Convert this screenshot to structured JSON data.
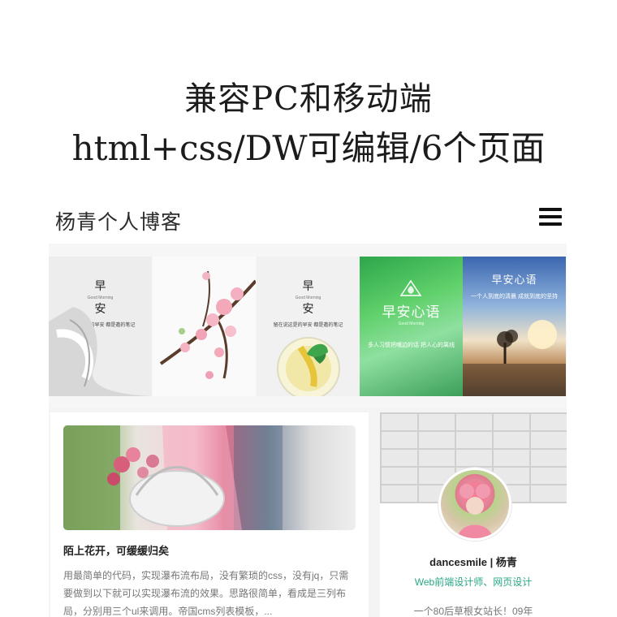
{
  "promo": {
    "line1": "兼容PC和移动端",
    "line2": "html+css/DW可编辑/6个页面"
  },
  "header": {
    "logo": "杨青个人博客",
    "menu_icon": "hamburger-menu-icon"
  },
  "banner": {
    "tiles": [
      {
        "kind": "card",
        "char1": "早",
        "char2": "安",
        "tiny": "Good Morning",
        "text": "留在说这是的早安 都是邀的笔记"
      },
      {
        "kind": "blossom"
      },
      {
        "kind": "card",
        "char1": "早",
        "char2": "安",
        "tiny": "Good Morning",
        "text": "留在说这是的早安 都是邀的笔记"
      },
      {
        "kind": "green",
        "title": "早安心语",
        "tiny": "Good Morning",
        "text": "多人习惯把嘴边的话 把人心的离线"
      },
      {
        "kind": "sky",
        "title": "早安心语",
        "text": "一个人到底的清晨 成就到底的坚持"
      }
    ]
  },
  "post": {
    "title": "陌上花开，可缓缓归矣",
    "excerpt": "用最简单的代码，实现瀑布流布局，没有繁琐的css，没有jq，只需要做到以下就可以实现瀑布流的效果。思路很简单，看成是三列布局，分别用三个ul来调用。帝国cms列表模板，..."
  },
  "profile": {
    "name": "dancesmile | 杨青",
    "role": "Web前端设计师、网页设计",
    "desc": "一个80后草根女站长！09年"
  },
  "colors": {
    "accent": "#28a786",
    "text": "#333333"
  }
}
